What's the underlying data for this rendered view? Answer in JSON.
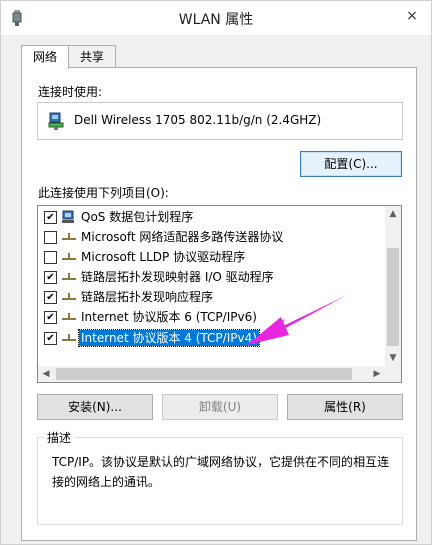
{
  "window": {
    "title": "WLAN 属性",
    "close_label": "×"
  },
  "tabs": [
    {
      "label": "网络"
    },
    {
      "label": "共享"
    }
  ],
  "connect_using": {
    "label": "连接时使用:",
    "adapter": "Dell Wireless 1705 802.11b/g/n (2.4GHZ)",
    "configure_label": "配置(C)..."
  },
  "items_label": "此连接使用下列项目(O):",
  "items": [
    {
      "label": "QoS 数据包计划程序",
      "checked": true,
      "icon": "network-service-icon"
    },
    {
      "label": "Microsoft 网络适配器多路传送器协议",
      "checked": false,
      "icon": "protocol-icon"
    },
    {
      "label": "Microsoft LLDP 协议驱动程序",
      "checked": false,
      "icon": "protocol-icon"
    },
    {
      "label": "链路层拓扑发现映射器 I/O 驱动程序",
      "checked": true,
      "icon": "protocol-icon"
    },
    {
      "label": "链路层拓扑发现响应程序",
      "checked": true,
      "icon": "protocol-icon"
    },
    {
      "label": "Internet 协议版本 6 (TCP/IPv6)",
      "checked": true,
      "icon": "protocol-icon"
    },
    {
      "label": "Internet 协议版本 4 (TCP/IPv4)",
      "checked": true,
      "icon": "protocol-icon",
      "selected": true
    }
  ],
  "buttons": {
    "install": "安装(N)...",
    "uninstall": "卸载(U)",
    "properties": "属性(R)"
  },
  "description": {
    "title": "描述",
    "text": "TCP/IP。该协议是默认的广域网络协议，它提供在不同的相互连接的网络上的通讯。"
  },
  "colors": {
    "selection": "#0078d7",
    "annotation_arrow": "#e826e0"
  }
}
